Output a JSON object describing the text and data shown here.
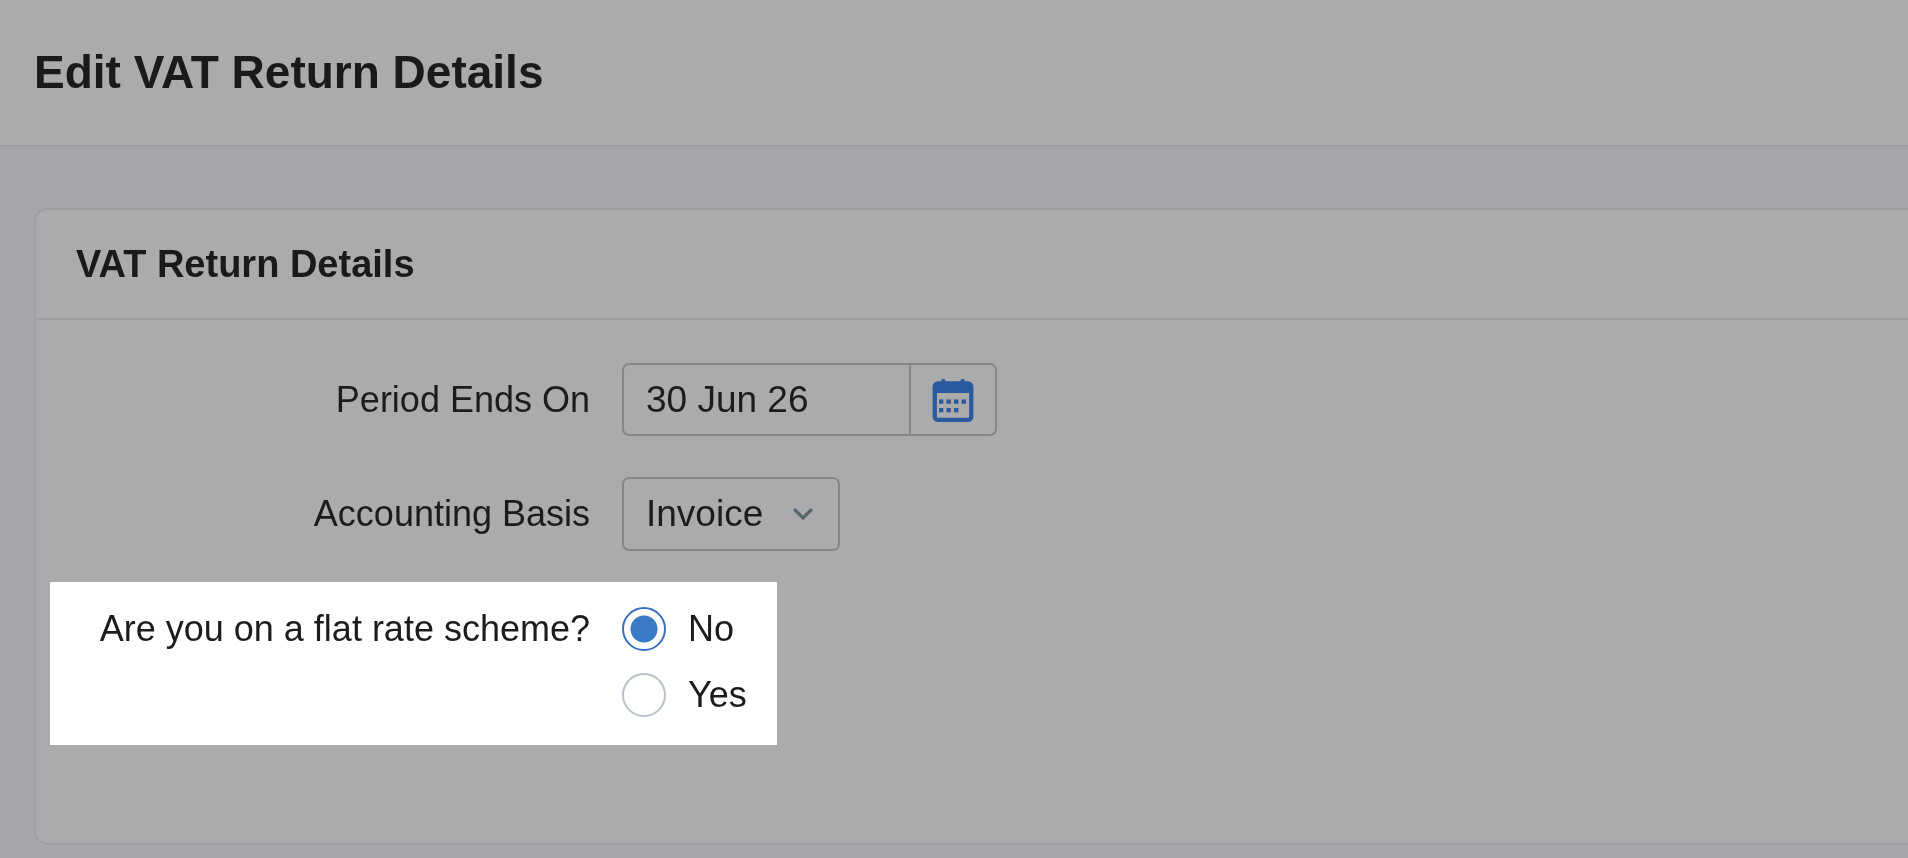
{
  "page": {
    "title": "Edit VAT Return Details"
  },
  "card": {
    "title": "VAT Return Details",
    "fields": [
      {
        "kind": "date",
        "label": "Period Ends On",
        "value": "30 Jun 26"
      },
      {
        "kind": "select",
        "label": "Accounting Basis",
        "value": "Invoice"
      },
      {
        "kind": "radio",
        "label": "Are you on a flat rate scheme?",
        "highlighted": true,
        "options": [
          {
            "label": "No",
            "selected": true
          },
          {
            "label": "Yes",
            "selected": false
          }
        ]
      }
    ]
  }
}
